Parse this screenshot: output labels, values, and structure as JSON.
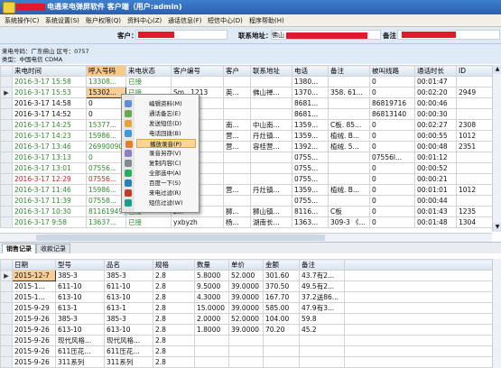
{
  "titlebar": {
    "title": "电通来电弹屏软件 客户端（用户:admin)"
  },
  "menu": [
    "系统操作(C)",
    "系统设置(S)",
    "账户权限(Q)",
    "资料中心(Z)",
    "通话信息(F)",
    "短信中心(D)",
    "程序帮助(H)"
  ],
  "header": {
    "customer_label": "客户：",
    "address_label": "联系地址：",
    "address_value": "佛山",
    "remark_label": "备注："
  },
  "info": {
    "line1_label": "来电号码：",
    "line1_value": "广东佛山  区号：0757",
    "line2_label": "类型：",
    "line2_value": "中国电信 CDMA"
  },
  "calls": {
    "columns": [
      "来电时间",
      "呼入号码",
      "来电状态",
      "客户编号",
      "客户",
      "联系地址",
      "电话",
      "备注",
      "被叫线路",
      "通话时长",
      "ID"
    ],
    "rows": [
      {
        "time": "2016-3-17 15:58",
        "number": "13308...",
        "status": "已接",
        "cust_no": "",
        "cust": "",
        "addr": "",
        "phone": "1380...",
        "remark": "",
        "line": "0",
        "dur": "00:01:47",
        "id": "",
        "tc": "g"
      },
      {
        "time": "2016-3-17 15:53",
        "number": "15302...",
        "status": "已接",
        "cust_no": "Sm...1213",
        "cust": "英...",
        "addr": "佛山禅...",
        "phone": "1370...",
        "remark": "358. 61...",
        "line": "0",
        "dur": "00:02:20",
        "id": "2949",
        "tc": "g"
      },
      {
        "time": "2016-3-17 14:58",
        "number": "0",
        "status": "",
        "cust_no": "",
        "cust": "",
        "addr": "",
        "phone": "8681...",
        "remark": "",
        "line": "86819716",
        "dur": "00:00:46",
        "id": "",
        "tc": ""
      },
      {
        "time": "2016-3-17 14:52",
        "number": "0",
        "status": "",
        "cust_no": "",
        "cust": "",
        "addr": "",
        "phone": "8681...",
        "remark": "",
        "line": "86813140",
        "dur": "00:00:30",
        "id": "",
        "tc": ""
      },
      {
        "time": "2016-3-17 14:25",
        "number": "15377...",
        "status": "",
        "cust_no": "",
        "cust": "南...",
        "addr": "中山南...",
        "phone": "1359...",
        "remark": "C板. 85...",
        "line": "0",
        "dur": "00:02:27",
        "id": "2308",
        "tc": "g"
      },
      {
        "time": "2016-3-17 14:23",
        "number": "15986...",
        "status": "",
        "cust_no": "",
        "cust": "营...",
        "addr": "丹灶镇...",
        "phone": "1359...",
        "remark": "植绒. B...",
        "line": "0",
        "dur": "00:00:55",
        "id": "1012",
        "tc": "g"
      },
      {
        "time": "2016-3-17 13:46",
        "number": "26990090",
        "status": "",
        "cust_no": "",
        "cust": "营...",
        "addr": "容桂营...",
        "phone": "1392...",
        "remark": "植绒. 5...",
        "line": "0",
        "dur": "00:00:48",
        "id": "2351",
        "tc": "g"
      },
      {
        "time": "2016-3-17 13:13",
        "number": "0",
        "status": "",
        "cust_no": "",
        "cust": "",
        "addr": "",
        "phone": "0755...",
        "remark": "",
        "line": "07556l...",
        "dur": "00:01:12",
        "id": "",
        "tc": "g"
      },
      {
        "time": "2016-3-17 13:01",
        "number": "07556...",
        "status": "",
        "cust_no": "",
        "cust": "",
        "addr": "",
        "phone": "0755...",
        "remark": "",
        "line": "0",
        "dur": "00:00:52",
        "id": "",
        "tc": "g"
      },
      {
        "time": "2016-3-17 12:29",
        "number": "07556...",
        "status": "",
        "cust_no": "",
        "cust": "",
        "addr": "",
        "phone": "0755...",
        "remark": "",
        "line": "0",
        "dur": "00:00:21",
        "id": "",
        "tc": "r"
      },
      {
        "time": "2016-3-17 11:46",
        "number": "15986...",
        "status": "",
        "cust_no": "",
        "cust": "营...",
        "addr": "丹灶镇...",
        "phone": "1359...",
        "remark": "植绒. B...",
        "line": "0",
        "dur": "00:01:01",
        "id": "1012",
        "tc": "g"
      },
      {
        "time": "2016-3-17 11:39",
        "number": "07558...",
        "status": "",
        "cust_no": "",
        "cust": "",
        "addr": "",
        "phone": "0755...",
        "remark": "",
        "line": "0",
        "dur": "00:00:44",
        "id": "",
        "tc": "g"
      },
      {
        "time": "2016-3-17 10:30",
        "number": "81161949",
        "status": "已接",
        "cust_no": "z...",
        "cust": "狮...",
        "addr": "狮山镇...",
        "phone": "8116...",
        "remark": "C板",
        "line": "0",
        "dur": "00:01:43",
        "id": "1235",
        "tc": "g"
      },
      {
        "time": "2016-3-17 9:58",
        "number": "13637...",
        "status": "已接",
        "cust_no": "yxbyzh",
        "cust": "杨...",
        "addr": "湖南长...",
        "phone": "1363...",
        "remark": "309-3 《...",
        "line": "0",
        "dur": "00:01:48",
        "id": "1304",
        "tc": "g"
      }
    ]
  },
  "context_menu": {
    "items": [
      "编辑资料(M)",
      "通话备忘(E)",
      "发送短信(D)",
      "电话回拨(B)",
      "播放录音(P)",
      "录音另存(V)",
      "复制内容(C)",
      "全部选中(A)",
      "百度一下(S)",
      "来电过滤(R)",
      "短信过滤(W)"
    ],
    "selected_index": 4
  },
  "tabs": {
    "items": [
      "销售记录",
      "收款记录"
    ],
    "active_index": 0
  },
  "sales": {
    "columns": [
      "日期",
      "型号",
      "品名",
      "规格",
      "数量",
      "单价",
      "金额",
      "备注"
    ],
    "rows": [
      [
        "2015-12-7",
        "385-3",
        "385-3",
        "2.8",
        "5.8000",
        "52.000",
        "301.60",
        "43.7有2..."
      ],
      [
        "2015-1...",
        "611-10",
        "611-10",
        "2.8",
        "9.5000",
        "39.0000",
        "370.50",
        "49.5有2..."
      ],
      [
        "2015-1...",
        "613-10",
        "613-10",
        "2.8",
        "4.3000",
        "39.0000",
        "167.70",
        "37.2送86..."
      ],
      [
        "2015-9-29",
        "613-1",
        "613-1",
        "2.8",
        "15.0000",
        "39.0000",
        "585.00",
        "47.9有3..."
      ],
      [
        "2015-9-26",
        "385-3",
        "385-3",
        "2.8",
        "2.0000",
        "52.0000",
        "104.00",
        "59.8"
      ],
      [
        "2015-9-26",
        "613-10",
        "613-10",
        "2.8",
        "1.8000",
        "39.0000",
        "70.20",
        "45.2"
      ],
      [
        "2015-9-26",
        "现代风格...",
        "现代风格...",
        "2.8",
        "",
        "",
        "",
        ""
      ],
      [
        "2015-9-26",
        "611压花...",
        "611压花...",
        "2.8",
        "",
        "",
        "",
        ""
      ],
      [
        "2015-9-26",
        "311系列",
        "311系列",
        "2.8",
        "",
        "",
        "",
        ""
      ]
    ]
  }
}
